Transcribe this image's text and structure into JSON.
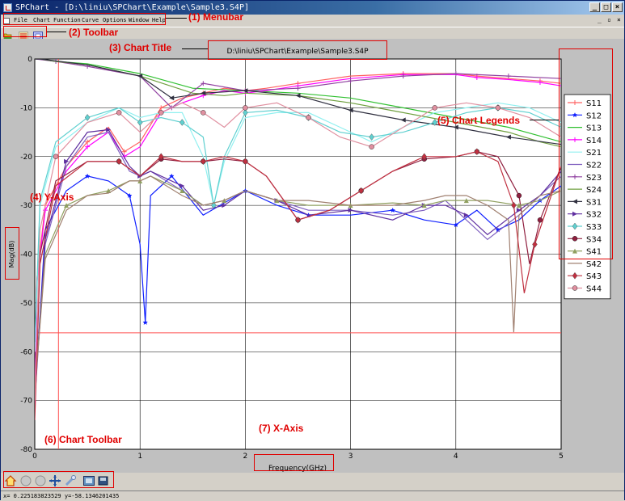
{
  "window": {
    "title": "SPChart - [D:\\liniu\\SPChart\\Example\\Sample3.S4P]",
    "controls": [
      "_",
      "□",
      "×"
    ],
    "mdi_controls": [
      "_",
      "▫",
      "×"
    ]
  },
  "menubar": {
    "items": [
      "File",
      "Chart",
      "Function",
      "Curve",
      "Options",
      "Window",
      "Help"
    ]
  },
  "annotations": {
    "menubar": "(1) Menubar",
    "toolbar": "(2) Toolbar",
    "chart_title": "(3) Chart Title",
    "y_axis": "(4) Y-Axis",
    "legends": "(5) Chart Legends",
    "chart_toolbar": "(6) Chart Toolbar",
    "x_axis": "(7) X-Axis"
  },
  "statusbar": {
    "text": "x= 0.225183823529   y=-58.1346201435"
  },
  "colors": {
    "annotation": "#e00000",
    "plot_bg": "#ffffff",
    "frame_bg": "#c0c0c0"
  },
  "chart_data": {
    "type": "line",
    "title": "D:\\liniu\\SPChart\\Example\\Sample3.S4P",
    "xlabel": "Frequency(GHz)",
    "ylabel": "Mag(dB)",
    "xlim": [
      0,
      5
    ],
    "ylim": [
      -80,
      0
    ],
    "xticks": [
      0,
      1,
      2,
      3,
      4,
      5
    ],
    "yticks": [
      0,
      -10,
      -20,
      -30,
      -40,
      -50,
      -60,
      -70,
      -80
    ],
    "grid": true,
    "legend": "right",
    "cursor": {
      "x": 0.225183823529,
      "y": -56.1346201435
    },
    "series": [
      {
        "name": "S11",
        "color": "#ff6060",
        "marker": "plus",
        "x": [
          0,
          0.02,
          0.1,
          0.3,
          0.5,
          0.7,
          0.85,
          1.0,
          1.2,
          1.4,
          1.6,
          1.8,
          2.0,
          2.2,
          2.5,
          3.0,
          3.5,
          4.0,
          4.2,
          4.5,
          4.8,
          5.0
        ],
        "y": [
          -72,
          -45,
          -30,
          -22,
          -17,
          -14,
          -19,
          -17,
          -10,
          -8,
          -7,
          -6,
          -6.5,
          -6,
          -5,
          -3.5,
          -3,
          -3,
          -3.5,
          -4,
          -4.5,
          -5
        ]
      },
      {
        "name": "S12",
        "color": "#1020ff",
        "marker": "star",
        "x": [
          0,
          0.1,
          0.3,
          0.5,
          0.7,
          0.9,
          1.0,
          1.05,
          1.1,
          1.3,
          1.6,
          2.0,
          2.3,
          2.6,
          3.0,
          3.4,
          3.7,
          4.0,
          4.2,
          4.4,
          4.6,
          4.8,
          5.0
        ],
        "y": [
          -70,
          -35,
          -27,
          -24,
          -25,
          -28,
          -38,
          -54,
          -28,
          -24,
          -32,
          -27,
          -30,
          -32,
          -32,
          -31,
          -33,
          -34,
          -31,
          -35,
          -33,
          -29,
          -26
        ]
      },
      {
        "name": "S13",
        "color": "#30c030",
        "marker": "none",
        "x": [
          0,
          0.05,
          0.2,
          0.5,
          1.0,
          1.5,
          2.0,
          2.5,
          3.0,
          3.5,
          4.0,
          4.5,
          5.0
        ],
        "y": [
          0,
          0,
          -0.5,
          -1,
          -3,
          -6,
          -6.5,
          -7,
          -8,
          -10,
          -12,
          -14,
          -17
        ]
      },
      {
        "name": "S14",
        "color": "#ff00ff",
        "marker": "plus",
        "x": [
          0,
          0.02,
          0.1,
          0.3,
          0.5,
          0.7,
          0.85,
          1.0,
          1.2,
          1.4,
          1.6,
          1.8,
          2.0,
          2.2,
          2.5,
          3.0,
          3.5,
          4.0,
          4.2,
          4.5,
          4.8,
          5.0
        ],
        "y": [
          -72,
          -46,
          -31,
          -23,
          -18,
          -15,
          -20,
          -18,
          -11,
          -9,
          -7.5,
          -6.5,
          -7,
          -6.5,
          -5.5,
          -4,
          -3.2,
          -3.2,
          -3.8,
          -4.2,
          -4.8,
          -5.5
        ]
      },
      {
        "name": "S21",
        "color": "#90f0f0",
        "marker": "none",
        "x": [
          0,
          0.05,
          0.2,
          0.5,
          0.8,
          1.0,
          1.2,
          1.4,
          1.6,
          1.7,
          1.8,
          2.0,
          2.3,
          2.6,
          2.9,
          3.2,
          3.5,
          3.8,
          4.1,
          4.4,
          4.7,
          5.0
        ],
        "y": [
          -60,
          -30,
          -18,
          -13,
          -10,
          -12,
          -11,
          -11,
          -20,
          -30,
          -21,
          -12,
          -11,
          -11,
          -14,
          -17,
          -14,
          -11,
          -10,
          -9,
          -10,
          -13
        ]
      },
      {
        "name": "S22",
        "color": "#8060c0",
        "marker": "none",
        "x": [
          0,
          0.1,
          0.3,
          0.5,
          0.7,
          0.9,
          1.0,
          1.1,
          1.4,
          1.6,
          1.8,
          2.0,
          2.3,
          2.6,
          3.0,
          3.4,
          3.7,
          3.9,
          4.1,
          4.3,
          4.6,
          4.8,
          5.0
        ],
        "y": [
          -70,
          -38,
          -22,
          -16,
          -15,
          -23,
          -24,
          -23,
          -27,
          -30,
          -29,
          -27,
          -29,
          -31,
          -31,
          -32,
          -31,
          -29,
          -33,
          -37,
          -32,
          -28,
          -24
        ]
      },
      {
        "name": "S23",
        "color": "#9040a0",
        "marker": "plus",
        "x": [
          0,
          0.05,
          0.2,
          0.5,
          1.0,
          1.3,
          1.6,
          2.0,
          2.5,
          3.0,
          3.5,
          4.0,
          4.5,
          5.0
        ],
        "y": [
          0,
          -0.1,
          -0.5,
          -1.5,
          -3.5,
          -10,
          -5,
          -6.5,
          -6,
          -4.5,
          -3.5,
          -3,
          -3.5,
          -4
        ]
      },
      {
        "name": "S24",
        "color": "#70a040",
        "marker": "none",
        "x": [
          0,
          0.05,
          0.2,
          0.5,
          1.0,
          1.5,
          1.8,
          2.0,
          2.5,
          3.0,
          3.5,
          4.0,
          4.5,
          4.8,
          5.0
        ],
        "y": [
          0,
          0,
          -0.5,
          -1.2,
          -3.5,
          -7,
          -7.5,
          -7,
          -7.5,
          -9,
          -11,
          -13,
          -15,
          -17,
          -18
        ]
      },
      {
        "name": "S31",
        "color": "#303040",
        "marker": "tri-left",
        "x": [
          0,
          0.05,
          0.2,
          0.5,
          1.0,
          1.3,
          1.6,
          2.0,
          2.5,
          3.0,
          3.5,
          4.0,
          4.5,
          5.0
        ],
        "y": [
          0,
          0,
          -0.4,
          -1.2,
          -3.5,
          -8,
          -7,
          -6.5,
          -7.5,
          -10.5,
          -12.5,
          -14,
          -16,
          -17.5
        ]
      },
      {
        "name": "S32",
        "color": "#6030a0",
        "marker": "tri-right",
        "x": [
          0,
          0.1,
          0.3,
          0.5,
          0.7,
          0.9,
          1.0,
          1.1,
          1.4,
          1.6,
          1.8,
          2.0,
          2.3,
          2.6,
          3.0,
          3.4,
          3.7,
          3.9,
          4.1,
          4.3,
          4.6,
          4.8,
          5.0
        ],
        "y": [
          -69,
          -37,
          -21,
          -15,
          -14.5,
          -22,
          -24,
          -23,
          -26,
          -31,
          -30,
          -27,
          -29,
          -32,
          -31,
          -33,
          -30,
          -30,
          -32,
          -36,
          -31,
          -28,
          -23
        ]
      },
      {
        "name": "S33",
        "color": "#60d0d0",
        "marker": "diamond",
        "x": [
          0,
          0.05,
          0.2,
          0.5,
          0.8,
          1.0,
          1.2,
          1.4,
          1.6,
          1.7,
          1.8,
          2.0,
          2.3,
          2.6,
          2.9,
          3.2,
          3.5,
          3.8,
          4.1,
          4.4,
          4.7,
          5.0
        ],
        "y": [
          -58,
          -29,
          -17,
          -12,
          -10,
          -13,
          -12,
          -13,
          -16,
          -30,
          -20,
          -11,
          -10.5,
          -12,
          -15,
          -16,
          -15,
          -13,
          -11,
          -10,
          -11,
          -14
        ]
      },
      {
        "name": "S34",
        "color": "#902040",
        "marker": "circle",
        "x": [
          0,
          0.05,
          0.2,
          0.5,
          0.8,
          1.0,
          1.2,
          1.4,
          1.6,
          1.8,
          2.0,
          2.2,
          2.5,
          2.8,
          3.1,
          3.4,
          3.7,
          4.0,
          4.2,
          4.4,
          4.6,
          4.7,
          4.8,
          5.0
        ],
        "y": [
          -69,
          -40,
          -25,
          -21,
          -21,
          -24,
          -20.5,
          -21,
          -21,
          -20.5,
          -21,
          -24,
          -33,
          -31,
          -27,
          -23,
          -20.5,
          -20,
          -19,
          -20,
          -28,
          -42,
          -33,
          -22
        ]
      },
      {
        "name": "S41",
        "color": "#90a060",
        "marker": "triangle",
        "x": [
          0,
          0.1,
          0.3,
          0.5,
          0.7,
          0.9,
          1.0,
          1.1,
          1.4,
          1.6,
          1.8,
          2.0,
          2.3,
          2.6,
          3.0,
          3.4,
          3.7,
          3.9,
          4.1,
          4.3,
          4.6,
          4.8,
          5.0
        ],
        "y": [
          -68,
          -40,
          -30,
          -28,
          -27,
          -25,
          -25,
          -24,
          -27,
          -30,
          -29,
          -27,
          -29,
          -30,
          -30,
          -29.5,
          -30,
          -29,
          -29,
          -29,
          -30,
          -29,
          -27
        ]
      },
      {
        "name": "S42",
        "color": "#a08070",
        "marker": "none",
        "x": [
          0,
          0.1,
          0.3,
          0.5,
          0.7,
          0.9,
          1.0,
          1.1,
          1.4,
          1.6,
          1.8,
          2.0,
          2.3,
          2.6,
          3.0,
          3.4,
          3.7,
          3.9,
          4.1,
          4.3,
          4.5,
          4.55,
          4.6,
          4.8,
          5.0
        ],
        "y": [
          -68,
          -41,
          -31,
          -28,
          -27.5,
          -25,
          -25,
          -24,
          -28,
          -30,
          -29,
          -27,
          -29,
          -29,
          -30,
          -30,
          -29,
          -28,
          -28,
          -30,
          -33,
          -56,
          -32,
          -28,
          -27
        ]
      },
      {
        "name": "S43",
        "color": "#c03040",
        "marker": "diamond",
        "x": [
          0,
          0.05,
          0.2,
          0.5,
          0.8,
          1.0,
          1.2,
          1.4,
          1.6,
          1.8,
          2.0,
          2.2,
          2.5,
          2.8,
          3.1,
          3.4,
          3.7,
          4.0,
          4.2,
          4.4,
          4.55,
          4.65,
          4.75,
          5.0
        ],
        "y": [
          -74,
          -42,
          -26,
          -21,
          -21,
          -24,
          -20,
          -21,
          -21,
          -20,
          -21,
          -24,
          -33,
          -31,
          -27,
          -23,
          -20,
          -20,
          -19,
          -21,
          -30,
          -48,
          -38,
          -22
        ]
      },
      {
        "name": "S44",
        "color": "#e090a0",
        "marker": "circle",
        "x": [
          0,
          0.05,
          0.2,
          0.5,
          0.8,
          1.0,
          1.2,
          1.4,
          1.6,
          1.8,
          2.0,
          2.3,
          2.6,
          2.9,
          3.2,
          3.5,
          3.8,
          4.1,
          4.4,
          4.7,
          5.0
        ],
        "y": [
          -70,
          -35,
          -20,
          -13,
          -11,
          -15,
          -11,
          -9,
          -11,
          -14,
          -10,
          -9,
          -12,
          -16,
          -18,
          -14,
          -10,
          -9,
          -10,
          -12,
          -16
        ]
      }
    ]
  }
}
